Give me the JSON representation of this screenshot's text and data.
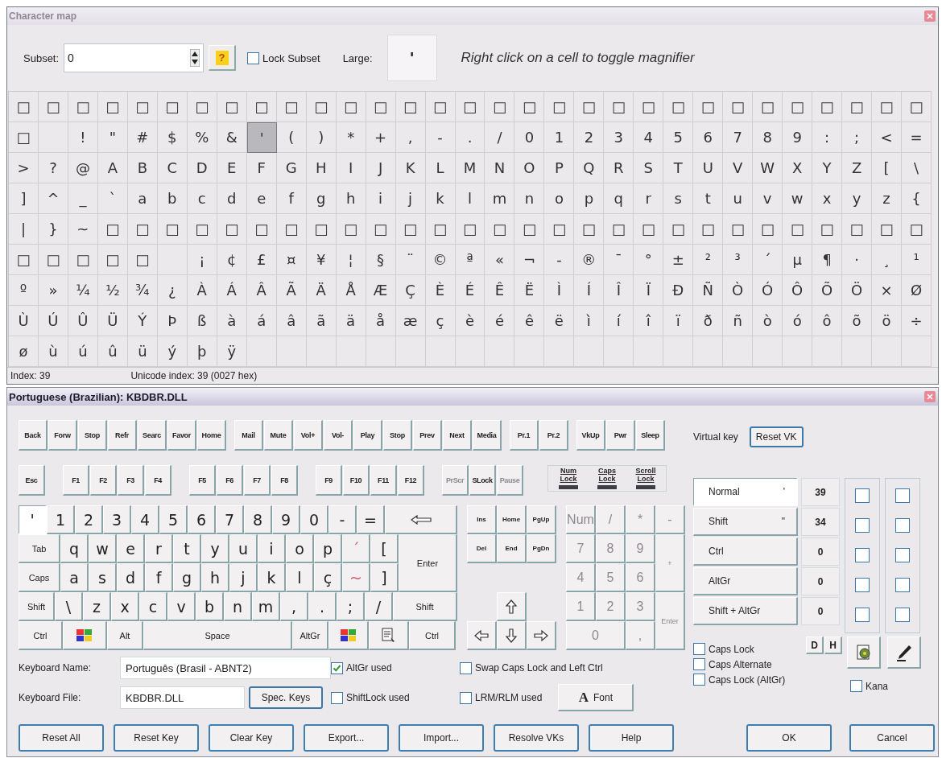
{
  "char_window": {
    "title": "Character map",
    "toolbar": {
      "subset_label": "Subset:",
      "subset_value": "0",
      "help_button": "?",
      "lock_subset": {
        "label": "Lock Subset",
        "checked": false
      },
      "large_label": "Large:",
      "large_preview": "'",
      "hint": "Right click on a cell to toggle magnifier"
    },
    "grid": {
      "rows": [
        [
          "□",
          "□",
          "□",
          "□",
          "□",
          "□",
          "□",
          "□",
          "□",
          "□",
          "□",
          "□",
          "□",
          "□",
          "□",
          "□",
          "□",
          "□",
          "□",
          "□",
          "□",
          "□",
          "□",
          "□",
          "□",
          "□",
          "□",
          "□",
          "□",
          "□",
          "□"
        ],
        [
          "□",
          null,
          "!",
          "\"",
          "#",
          "$",
          "%",
          "&",
          {
            "char": "'",
            "selected": true
          },
          "(",
          ")",
          "*",
          "+",
          ",",
          "-",
          ".",
          "/",
          "0",
          "1",
          "2",
          "3",
          "4",
          "5",
          "6",
          "7",
          "8",
          "9",
          ":",
          ";",
          "<",
          "="
        ],
        [
          ">",
          "?",
          "@",
          "A",
          "B",
          "C",
          "D",
          "E",
          "F",
          "G",
          "H",
          "I",
          "J",
          "K",
          "L",
          "M",
          "N",
          "O",
          "P",
          "Q",
          "R",
          "S",
          "T",
          "U",
          "V",
          "W",
          "X",
          "Y",
          "Z",
          "[",
          "\\"
        ],
        [
          "]",
          "^",
          "_",
          "`",
          "a",
          "b",
          "c",
          "d",
          "e",
          "f",
          "g",
          "h",
          "i",
          "j",
          "k",
          "l",
          "m",
          "n",
          "o",
          "p",
          "q",
          "r",
          "s",
          "t",
          "u",
          "v",
          "w",
          "x",
          "y",
          "z",
          "{"
        ],
        [
          "|",
          "}",
          "~",
          "□",
          "□",
          "□",
          "□",
          "□",
          "□",
          "□",
          "□",
          "□",
          "□",
          "□",
          "□",
          "□",
          "□",
          "□",
          "□",
          "□",
          "□",
          "□",
          "□",
          "□",
          "□",
          "□",
          "□",
          "□",
          "□",
          "□",
          "□"
        ],
        [
          "□",
          "□",
          "□",
          "□",
          "□",
          null,
          "¡",
          "¢",
          "£",
          "¤",
          "¥",
          "¦",
          "§",
          "¨",
          "©",
          "ª",
          "«",
          "¬",
          "-",
          "®",
          "¯",
          "°",
          "±",
          "²",
          "³",
          "´",
          "µ",
          "¶",
          "·",
          "¸",
          "¹"
        ],
        [
          "º",
          "»",
          "¼",
          "½",
          "¾",
          "¿",
          "À",
          "Á",
          "Â",
          "Ã",
          "Ä",
          "Å",
          "Æ",
          "Ç",
          "È",
          "É",
          "Ê",
          "Ë",
          "Ì",
          "Í",
          "Î",
          "Ï",
          "Ð",
          "Ñ",
          "Ò",
          "Ó",
          "Ô",
          "Õ",
          "Ö",
          "×",
          "Ø"
        ],
        [
          "Ù",
          "Ú",
          "Û",
          "Ü",
          "Ý",
          "Þ",
          "ß",
          "à",
          "á",
          "â",
          "ã",
          "ä",
          "å",
          "æ",
          "ç",
          "è",
          "é",
          "ê",
          "ë",
          "ì",
          "í",
          "î",
          "ï",
          "ð",
          "ñ",
          "ò",
          "ó",
          "ô",
          "õ",
          "ö",
          "÷"
        ],
        [
          "ø",
          "ù",
          "ú",
          "û",
          "ü",
          "ý",
          "þ",
          "ÿ"
        ]
      ]
    },
    "status": {
      "index": "Index: 39",
      "unicode": "Unicode index: 39 (0027 hex)"
    }
  },
  "keyboard_window": {
    "title": "Portuguese (Brazilian): KBDBR.DLL",
    "media_groups": [
      [
        "Back",
        "Forw",
        "Stop",
        "Refr",
        "Searc",
        "Favor",
        "Home"
      ],
      [
        "Mail",
        "Mute",
        "Vol+",
        "Vol-",
        "Play",
        "Stop",
        "Prev",
        "Next",
        "Media"
      ],
      [
        "Pr.1",
        "Pr.2"
      ],
      [
        "VkUp",
        "Pwr",
        "Sleep"
      ]
    ],
    "function_groups": [
      [
        {
          "label": "Esc",
          "disabled": false
        }
      ],
      [
        {
          "label": "F1",
          "disabled": false
        },
        {
          "label": "F2",
          "disabled": false
        },
        {
          "label": "F3",
          "disabled": false
        },
        {
          "label": "F4",
          "disabled": false
        }
      ],
      [
        {
          "label": "F5",
          "disabled": false
        },
        {
          "label": "F6",
          "disabled": false
        },
        {
          "label": "F7",
          "disabled": false
        },
        {
          "label": "F8",
          "disabled": false
        }
      ],
      [
        {
          "label": "F9",
          "disabled": false
        },
        {
          "label": "F10",
          "disabled": false
        },
        {
          "label": "F11",
          "disabled": false
        },
        {
          "label": "F12",
          "disabled": false
        }
      ],
      [
        {
          "label": "PrScr",
          "disabled": true
        },
        {
          "label": "SLock",
          "disabled": false
        },
        {
          "label": "Pause",
          "disabled": true
        }
      ]
    ],
    "locks": [
      {
        "label": "Num Lock",
        "on": false
      },
      {
        "label": "Caps Lock",
        "on": false
      },
      {
        "label": "Scroll Lock",
        "on": false
      }
    ],
    "main_rows": [
      [
        {
          "label": "'",
          "kind": "char",
          "selected": true
        },
        {
          "label": "1",
          "kind": "char",
          "selected": false
        },
        {
          "label": "2",
          "kind": "char",
          "selected": false
        },
        {
          "label": "3",
          "kind": "char",
          "selected": false
        },
        {
          "label": "4",
          "kind": "char",
          "selected": false
        },
        {
          "label": "5",
          "kind": "char",
          "selected": false
        },
        {
          "label": "6",
          "kind": "char",
          "selected": false
        },
        {
          "label": "7",
          "kind": "char",
          "selected": false
        },
        {
          "label": "8",
          "kind": "char",
          "selected": false
        },
        {
          "label": "9",
          "kind": "char",
          "selected": false
        },
        {
          "label": "0",
          "kind": "char",
          "selected": false
        },
        {
          "label": "-",
          "kind": "char",
          "selected": false
        },
        {
          "label": "=",
          "kind": "char",
          "selected": false
        },
        {
          "kind": "backspace",
          "selected": false
        }
      ],
      [
        {
          "label": "Tab",
          "kind": "tab",
          "selected": false
        },
        {
          "label": "q",
          "kind": "char",
          "selected": false
        },
        {
          "label": "w",
          "kind": "char",
          "selected": false
        },
        {
          "label": "e",
          "kind": "char",
          "selected": false
        },
        {
          "label": "r",
          "kind": "char",
          "selected": false
        },
        {
          "label": "t",
          "kind": "char",
          "selected": false
        },
        {
          "label": "y",
          "kind": "char",
          "selected": false
        },
        {
          "label": "u",
          "kind": "char",
          "selected": false
        },
        {
          "label": "i",
          "kind": "char",
          "selected": false
        },
        {
          "label": "o",
          "kind": "char",
          "selected": false
        },
        {
          "label": "p",
          "kind": "char",
          "selected": false
        },
        {
          "label": "´",
          "kind": "dead",
          "selected": false
        },
        {
          "label": "[",
          "kind": "char",
          "selected": false
        }
      ],
      [
        {
          "label": "Caps",
          "kind": "caps",
          "selected": false
        },
        {
          "label": "a",
          "kind": "char",
          "selected": false
        },
        {
          "label": "s",
          "kind": "char",
          "selected": false
        },
        {
          "label": "d",
          "kind": "char",
          "selected": false
        },
        {
          "label": "f",
          "kind": "char",
          "selected": false
        },
        {
          "label": "g",
          "kind": "char",
          "selected": false
        },
        {
          "label": "h",
          "kind": "char",
          "selected": false
        },
        {
          "label": "j",
          "kind": "char",
          "selected": false
        },
        {
          "label": "k",
          "kind": "char",
          "selected": false
        },
        {
          "label": "l",
          "kind": "char",
          "selected": false
        },
        {
          "label": "ç",
          "kind": "char",
          "selected": false
        },
        {
          "label": "~",
          "kind": "dead",
          "selected": false
        },
        {
          "label": "]",
          "kind": "char",
          "selected": false
        }
      ],
      [
        {
          "label": "Shift",
          "kind": "shift",
          "selected": false
        },
        {
          "label": "\\",
          "kind": "char",
          "selected": false
        },
        {
          "label": "z",
          "kind": "char",
          "selected": false
        },
        {
          "label": "x",
          "kind": "char",
          "selected": false
        },
        {
          "label": "c",
          "kind": "char",
          "selected": false
        },
        {
          "label": "v",
          "kind": "char",
          "selected": false
        },
        {
          "label": "b",
          "kind": "char",
          "selected": false
        },
        {
          "label": "n",
          "kind": "char",
          "selected": false
        },
        {
          "label": "m",
          "kind": "char",
          "selected": false
        },
        {
          "label": ",",
          "kind": "char",
          "selected": false
        },
        {
          "label": ".",
          "kind": "char",
          "selected": false
        },
        {
          "label": ";",
          "kind": "char",
          "selected": false
        },
        {
          "label": "/",
          "kind": "char",
          "selected": false
        },
        {
          "label": "Shift",
          "kind": "shift_r",
          "selected": false
        }
      ],
      [
        {
          "label": "Ctrl",
          "kind": "ctrl",
          "selected": false
        },
        {
          "kind": "win",
          "selected": false
        },
        {
          "label": "Alt",
          "kind": "alt",
          "selected": false
        },
        {
          "label": "Space",
          "kind": "space",
          "selected": false
        },
        {
          "label": "AltGr",
          "kind": "altgr",
          "selected": false
        },
        {
          "kind": "win_r",
          "selected": false
        },
        {
          "kind": "menu",
          "selected": false
        },
        {
          "label": "Ctrl",
          "kind": "ctrl_r",
          "selected": false
        }
      ]
    ],
    "enter_key": {
      "label": "Enter",
      "selected": false
    },
    "nav_keys": [
      [
        "Ins",
        "Home",
        "PgUp"
      ],
      [
        "Del",
        "End",
        "PgDn"
      ]
    ],
    "arrow_keys": [
      {
        "kind": "up"
      },
      {
        "kind": "left"
      },
      {
        "kind": "down"
      },
      {
        "kind": "right"
      }
    ],
    "numpad": {
      "disabled": true,
      "keys": [
        {
          "label": "Num",
          "kind": "key"
        },
        {
          "label": "/",
          "kind": "key"
        },
        {
          "label": "*",
          "kind": "key"
        },
        {
          "label": "-",
          "kind": "key"
        },
        {
          "label": "7",
          "kind": "key"
        },
        {
          "label": "8",
          "kind": "key"
        },
        {
          "label": "9",
          "kind": "key"
        },
        {
          "label": "+",
          "kind": "tall"
        },
        {
          "label": "4",
          "kind": "key"
        },
        {
          "label": "5",
          "kind": "key"
        },
        {
          "label": "6",
          "kind": "key"
        },
        {
          "label": "1",
          "kind": "key"
        },
        {
          "label": "2",
          "kind": "key"
        },
        {
          "label": "3",
          "kind": "key"
        },
        {
          "label": "Enter",
          "kind": "tall"
        },
        {
          "label": "0",
          "kind": "wide"
        },
        {
          "label": ",",
          "kind": "key"
        }
      ]
    },
    "virtual_key_label": "Virtual key",
    "reset_vk_button": "Reset VK",
    "shift_states": [
      {
        "label": "Normal",
        "char": "'",
        "code": "39",
        "selected": true,
        "check_1": false,
        "check_2": false
      },
      {
        "label": "Shift",
        "char": "\"",
        "code": "34",
        "selected": false,
        "check_1": false,
        "check_2": false
      },
      {
        "label": "Ctrl",
        "code": "0",
        "selected": false,
        "check_1": false,
        "check_2": false
      },
      {
        "label": "AltGr",
        "code": "0",
        "selected": false,
        "check_1": false,
        "check_2": false
      },
      {
        "label": "Shift + AltGr",
        "code": "0",
        "selected": false,
        "check_1": false,
        "check_2": false
      }
    ],
    "radix_buttons": [
      "D",
      "H"
    ],
    "caps_options": [
      {
        "label": "Caps Lock",
        "checked": false
      },
      {
        "label": "Caps Alternate",
        "checked": false
      },
      {
        "label": "Caps Lock (AltGr)",
        "checked": false
      }
    ],
    "kana": {
      "label": "Kana",
      "checked": false
    },
    "keyboard_name": {
      "label": "Keyboard Name:",
      "value": "Português (Brasil - ABNT2)"
    },
    "keyboard_file": {
      "label": "Keyboard File:",
      "value": "KBDBR.DLL"
    },
    "spec_keys_button": "Spec. Keys",
    "options": [
      {
        "label": "AltGr used",
        "checked": true
      },
      {
        "label": "ShiftLock used",
        "checked": false
      },
      {
        "label": "Swap Caps Lock and Left Ctrl",
        "checked": false
      },
      {
        "label": "LRM/RLM used",
        "checked": false
      }
    ],
    "font_button": {
      "glyph": "A",
      "label": "Font"
    },
    "left_buttons": [
      "Reset All",
      "Reset Key",
      "Clear Key",
      "Export...",
      "Import...",
      "Resolve VKs",
      "Help"
    ],
    "right_buttons": [
      "OK",
      "Cancel"
    ]
  }
}
